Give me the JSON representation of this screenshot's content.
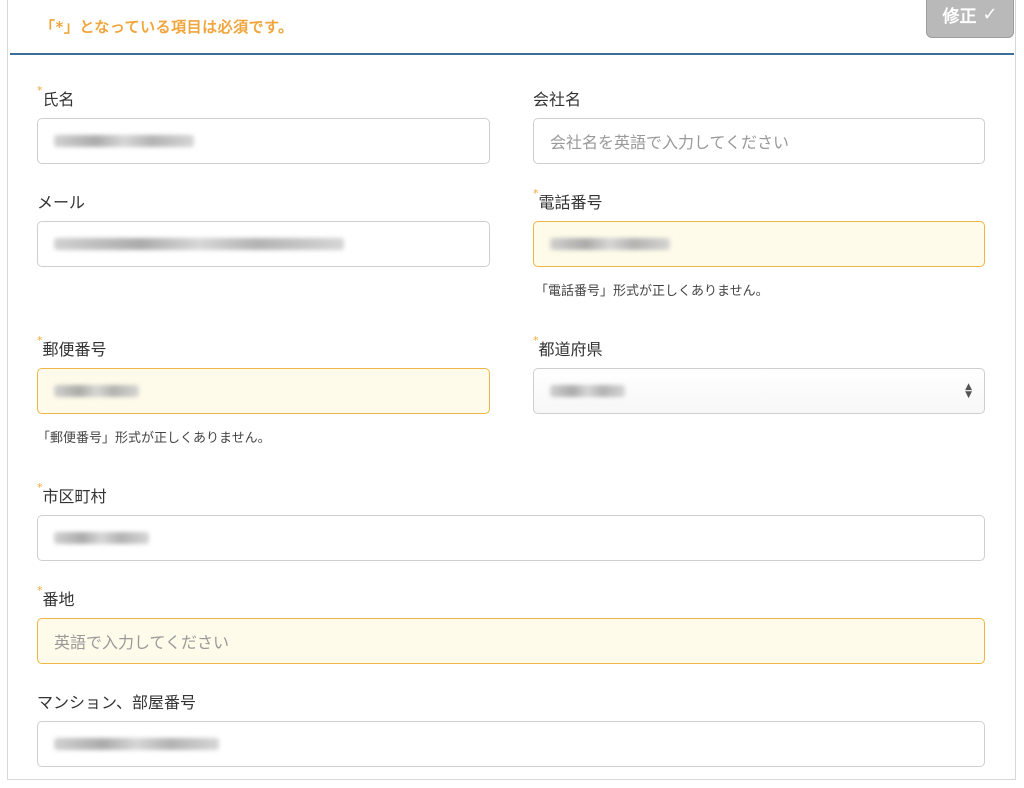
{
  "header": {
    "required_notice": "「*」となっている項目は必須です。",
    "edit_button_label": "修正",
    "edit_button_icon": "check-icon"
  },
  "fields": {
    "name": {
      "label": "氏名",
      "required": true,
      "value_masked": true
    },
    "company": {
      "label": "会社名",
      "required": false,
      "placeholder": "会社名を英語で入力してください"
    },
    "email": {
      "label": "メール",
      "required": false,
      "value_masked": true
    },
    "phone": {
      "label": "電話番号",
      "required": true,
      "value_masked": true,
      "error": "「電話番号」形式が正しくありません。"
    },
    "postal": {
      "label": "郵便番号",
      "required": true,
      "value_masked": true,
      "error": "「郵便番号」形式が正しくありません。"
    },
    "prefecture": {
      "label": "都道府県",
      "required": true,
      "value_masked": true
    },
    "city": {
      "label": "市区町村",
      "required": true,
      "value_masked": true
    },
    "street": {
      "label": "番地",
      "required": true,
      "placeholder": "英語で入力してください"
    },
    "building": {
      "label": "マンション、部屋番号",
      "required": false,
      "value_masked": true
    }
  },
  "required_mark": "*",
  "colors": {
    "accent": "#f0a63c",
    "divider": "#3a6f9a",
    "warn_bg": "#fffbea",
    "warn_border": "#f0b547",
    "button_bg": "#b9b9b9"
  }
}
